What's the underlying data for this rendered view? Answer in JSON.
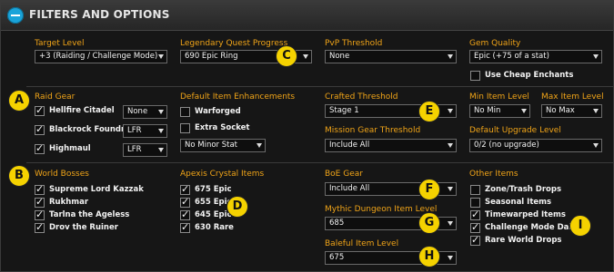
{
  "title": "FILTERS AND OPTIONS",
  "target_level": {
    "label": "Target Level",
    "value": "+3 (Raiding / Challenge Mode)"
  },
  "legendary_quest": {
    "label": "Legendary Quest Progress",
    "value": "690 Epic Ring"
  },
  "pvp_threshold": {
    "label": "PvP Threshold",
    "value": "None"
  },
  "gem_quality": {
    "label": "Gem Quality",
    "value": "Epic (+75 of a stat)"
  },
  "cheap_enchants": {
    "label": "Use Cheap Enchants"
  },
  "raid_gear": {
    "label": "Raid Gear",
    "items": [
      {
        "name": "Hellfire Citadel",
        "value": "None"
      },
      {
        "name": "Blackrock Foundry",
        "value": "LFR"
      },
      {
        "name": "Highmaul",
        "value": "LFR"
      }
    ]
  },
  "default_enhancements": {
    "label": "Default Item Enhancements",
    "warforged": "Warforged",
    "extra_socket": "Extra Socket",
    "minor_stat": "No Minor Stat"
  },
  "crafted_threshold": {
    "label": "Crafted Threshold",
    "value": "Stage 1"
  },
  "min_item_level": {
    "label": "Min Item Level",
    "value": "No Min"
  },
  "max_item_level": {
    "label": "Max Item Level",
    "value": "No Max"
  },
  "mission_gear": {
    "label": "Mission Gear Threshold",
    "value": "Include All"
  },
  "default_upgrade": {
    "label": "Default Upgrade Level",
    "value": "0/2 (no upgrade)"
  },
  "world_bosses": {
    "label": "World Bosses",
    "items": [
      "Supreme Lord Kazzak",
      "Rukhmar",
      "Tarlna the Ageless",
      "Drov the Ruiner"
    ]
  },
  "apexis": {
    "label": "Apexis Crystal Items",
    "items": [
      "675 Epic",
      "655 Epic",
      "645 Epic",
      "630 Rare"
    ]
  },
  "boe_gear": {
    "label": "BoE Gear",
    "value": "Include All"
  },
  "mythic_dungeon": {
    "label": "Mythic Dungeon Item Level",
    "value": "685"
  },
  "baleful": {
    "label": "Baleful Item Level",
    "value": "675"
  },
  "other_items": {
    "label": "Other Items",
    "items": [
      {
        "name": "Zone/Trash Drops",
        "checked": false
      },
      {
        "name": "Seasonal Items",
        "checked": false
      },
      {
        "name": "Timewarped Items",
        "checked": true
      },
      {
        "name": "Challenge Mode Daily",
        "checked": true
      },
      {
        "name": "Rare World Drops",
        "checked": true
      }
    ]
  },
  "badges": [
    "A",
    "B",
    "C",
    "D",
    "E",
    "F",
    "G",
    "H",
    "I"
  ],
  "colors": {
    "accent": "#f0a418",
    "badge": "#f5d200",
    "collapse": "#1aa3d9"
  }
}
